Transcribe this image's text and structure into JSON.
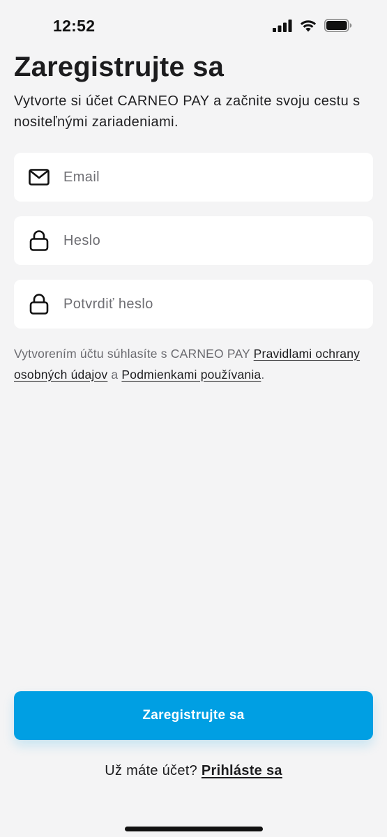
{
  "status_bar": {
    "time": "12:52",
    "icons": [
      "signal-icon",
      "wifi-icon",
      "battery-icon"
    ]
  },
  "header": {
    "title": "Zaregistrujte sa",
    "subtitle": "Vytvorte si účet CARNEO PAY a začnite svoju cestu s nositeľnými zariadeniami."
  },
  "form": {
    "email": {
      "placeholder": "Email",
      "value": "",
      "icon": "mail-icon"
    },
    "password": {
      "placeholder": "Heslo",
      "value": "",
      "icon": "lock-icon"
    },
    "confirm_password": {
      "placeholder": "Potvrdiť heslo",
      "value": "",
      "icon": "lock-icon"
    }
  },
  "terms": {
    "prefix": "Vytvorením účtu súhlasíte s CARNEO PAY ",
    "privacy_link": "Pravidlami ochrany osobných údajov",
    "conjunction": " a ",
    "terms_link": "Podmienkami používania",
    "suffix": "."
  },
  "actions": {
    "register_label": "Zaregistrujte sa",
    "login_prompt": "Už máte účet? ",
    "login_link": "Prihláste sa"
  },
  "colors": {
    "background": "#f4f4f5",
    "primary": "#009fe3",
    "input_background": "#ffffff",
    "text": "#1c1c1e",
    "muted_text": "#6b6b70"
  }
}
